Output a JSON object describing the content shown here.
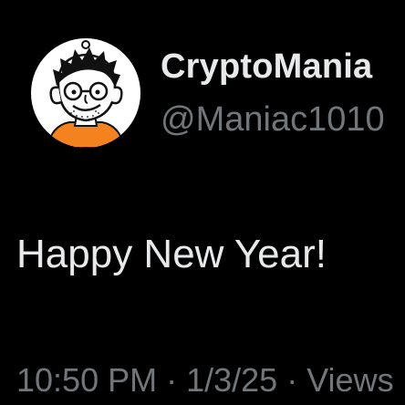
{
  "author": {
    "display_name": "CryptoMania",
    "handle": "@Maniac1010",
    "avatar_icon": "cartoon-face-avatar"
  },
  "tweet": {
    "text": "Happy New Year!"
  },
  "meta": {
    "time": "10:50 PM",
    "separator": " · ",
    "date": "1/3/25",
    "views_label": "Views"
  },
  "colors": {
    "background": "#000000",
    "primary_text": "#e7e9ea",
    "secondary_text": "#71767b",
    "avatar_shirt": "#f4831f"
  }
}
